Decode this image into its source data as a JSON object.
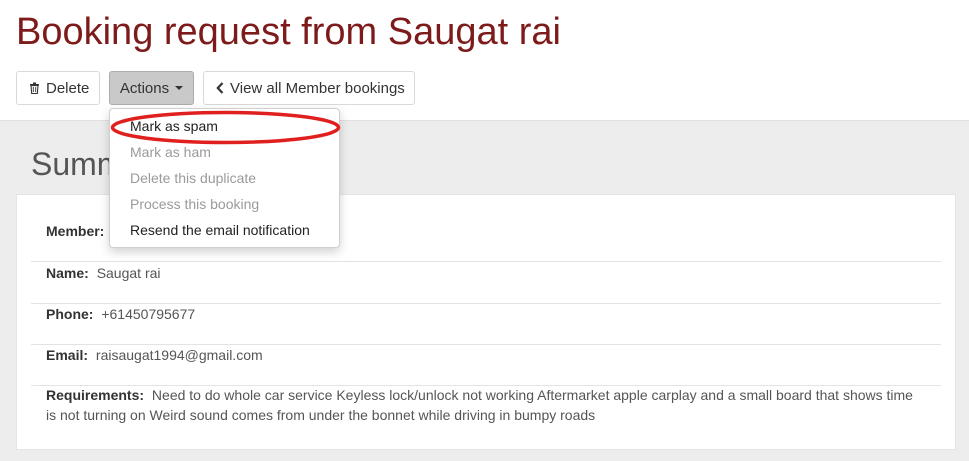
{
  "page": {
    "title": "Booking request from Saugat rai"
  },
  "toolbar": {
    "delete_label": "Delete",
    "actions_label": "Actions",
    "view_all_label": "View all Member bookings"
  },
  "summary": {
    "heading": "Summ"
  },
  "details": {
    "member_label": "Member:",
    "name_label": "Name:",
    "name_value": "Saugat rai",
    "phone_label": "Phone:",
    "phone_value": "+61450795677",
    "email_label": "Email:",
    "email_value": "raisaugat1994@gmail.com",
    "requirements_label": "Requirements:",
    "requirements_value": "Need to do whole car service Keyless lock/unlock not working Aftermarket apple carplay and a small board that shows time is not turning on Weird sound comes from under the bonnet while driving in bumpy roads"
  },
  "actions_menu": {
    "items": [
      {
        "label": "Mark as spam",
        "enabled": true
      },
      {
        "label": "Mark as ham",
        "enabled": false
      },
      {
        "label": "Delete this duplicate",
        "enabled": false
      },
      {
        "label": "Process this booking",
        "enabled": false
      },
      {
        "label": "Resend the email notification",
        "enabled": true
      }
    ]
  },
  "colors": {
    "title": "#7d1a1a",
    "highlight_annotation": "#e0201e",
    "actions_button_bg": "#c9c9c9"
  },
  "icons": {
    "delete": "trash-icon",
    "actions": "caret-down-icon",
    "view_all": "chevron-left-icon"
  }
}
